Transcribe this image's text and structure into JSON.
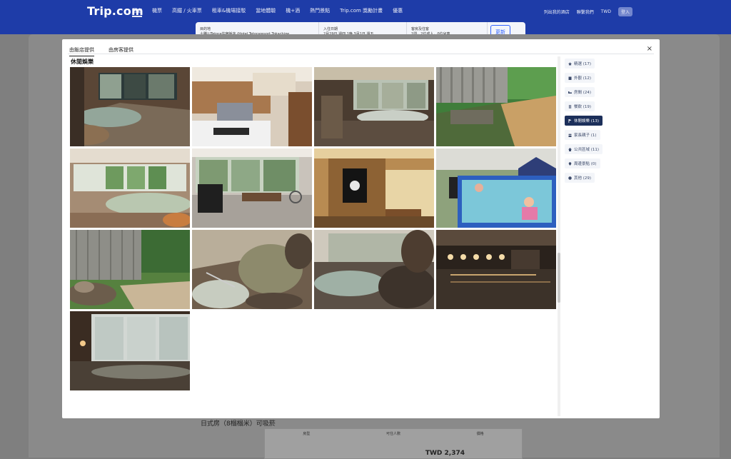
{
  "background": {
    "brand": "Trip.com",
    "nav": [
      "酒店",
      "機票",
      "高鐵 / 火車票",
      "租車&機場接駁",
      "當地體驗",
      "機+酒",
      "熱門景點",
      "Trip.com 獎勵計畫",
      "優惠"
    ],
    "right_nav": [
      "列出我的酒店",
      "聯繫我們",
      "TWD",
      "登入"
    ],
    "search": {
      "destination_label": "目的地",
      "destination": "十勝川Tetora住宿飯店 (Hotel Tetoraresort Tokachige...",
      "checkin_label": "入住日期",
      "checkin": "2月29日 週四",
      "nights": "1晚",
      "checkout_label": "退房日期",
      "checkout": "3月1日 週五",
      "guests_label": "客房及住客",
      "guests": "1間，2位成人，0位兒童",
      "update_button": "更新"
    },
    "room_section_title": "日式房（8榻榻米）可吸菸",
    "table_headers": [
      "房型",
      "可住人數",
      "價格"
    ],
    "price": "TWD 2,374"
  },
  "modal": {
    "tabs": [
      {
        "label": "由飯店提供",
        "active": true
      },
      {
        "label": "由房客提供",
        "active": false
      }
    ],
    "close_label": "×",
    "section_title": "休閒娛樂",
    "categories": [
      {
        "label": "精選 (17)",
        "icon": "star-icon",
        "active": false
      },
      {
        "label": "外觀 (12)",
        "icon": "building-icon",
        "active": false
      },
      {
        "label": "房間 (24)",
        "icon": "bed-icon",
        "active": false
      },
      {
        "label": "餐飲 (19)",
        "icon": "utensils-icon",
        "active": false
      },
      {
        "label": "休閒娛樂 (13)",
        "icon": "flag-icon",
        "active": true
      },
      {
        "label": "家長親子 (1)",
        "icon": "family-icon",
        "active": false
      },
      {
        "label": "公共區域 (11)",
        "icon": "home-icon",
        "active": false
      },
      {
        "label": "周邊景點 (0)",
        "icon": "pin-icon",
        "active": false
      },
      {
        "label": "其他 (29)",
        "icon": "dots-icon",
        "active": false
      }
    ],
    "photos": [
      "indoor-onsen-night",
      "lounge-chairs",
      "indoor-onsen-window",
      "outdoor-wood-deck",
      "large-indoor-bath",
      "massage-chair-room",
      "bath-entrance-noren",
      "kiddie-pool",
      "garden-rock-bath",
      "onsen-rock-pool",
      "onsen-steam",
      "onsen-lit-night",
      "misty-window-bath"
    ]
  }
}
